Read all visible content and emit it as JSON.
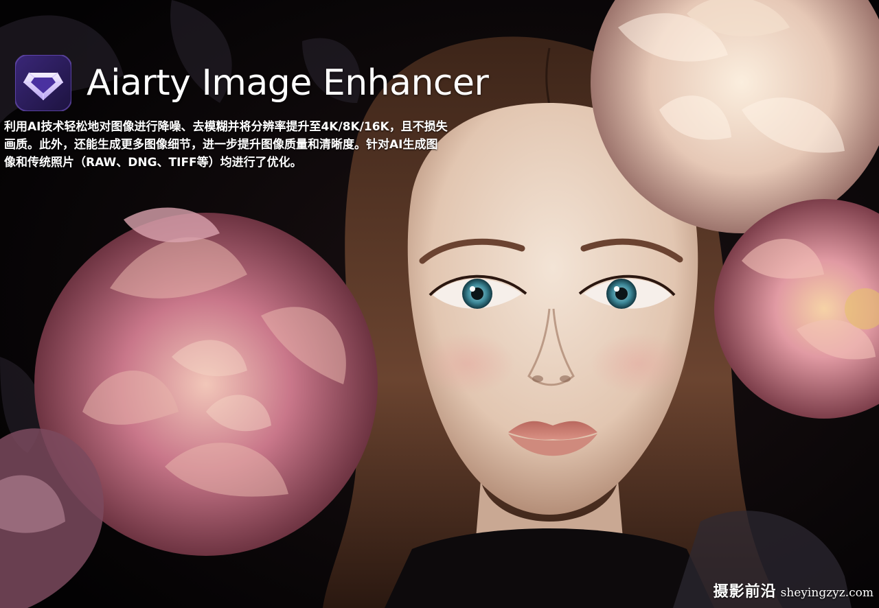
{
  "app": {
    "title": "Aiarty Image Enhancer",
    "logo_icon": "hexagon-crown-logo-icon",
    "logo_colors": [
      "#2a1c55",
      "#7b5bd6",
      "#efe9ff"
    ]
  },
  "description": {
    "lines": [
      "利用AI技术轻松地对图像进行降噪、去模糊并将分辨率提升至4K/8K/16K，且不损失",
      "画质。此外，还能生成更多图像细节，进一步提升图像质量和清晰度。针对AI生成图",
      "像和传统照片（RAW、DNG、TIFF等）均进行了优化。"
    ]
  },
  "watermark": {
    "label": "摄影前沿",
    "url": "sheyingzyz.com"
  },
  "palette": {
    "background": "#050304",
    "skin": "#efdccb",
    "hair": "#5a3a26",
    "iris": "#3f8a9a",
    "lips": "#c97f6f",
    "peony_pink": "#b9667a",
    "peony_cream": "#ecd5c3"
  }
}
